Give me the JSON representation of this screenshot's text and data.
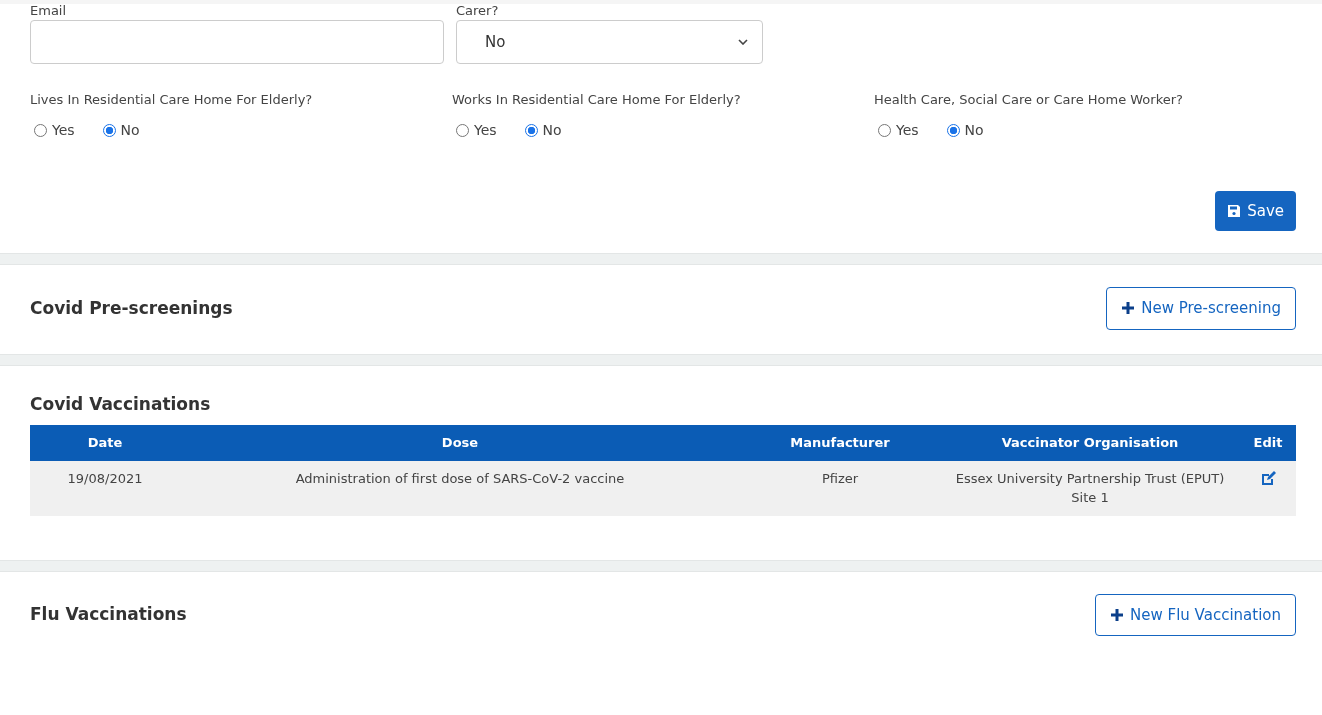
{
  "contact_form": {
    "fields": [
      {
        "label": "Email",
        "kind": "text"
      },
      {
        "label": "Carer?",
        "kind": "select",
        "value": "No"
      }
    ],
    "questions": [
      {
        "label": "Lives In Residential Care Home For Elderly?",
        "options": [
          {
            "label": "Yes",
            "selected": false
          },
          {
            "label": "No",
            "selected": true
          }
        ]
      },
      {
        "label": "Works In Residential Care Home For Elderly?",
        "options": [
          {
            "label": "Yes",
            "selected": false
          },
          {
            "label": "No",
            "selected": true
          }
        ]
      },
      {
        "label": "Health Care, Social Care or Care Home Worker?",
        "options": [
          {
            "label": "Yes",
            "selected": false
          },
          {
            "label": "No",
            "selected": true
          }
        ]
      }
    ],
    "save_button": "Save"
  },
  "sections": [
    {
      "title": "Covid Pre-screenings",
      "button": "New Pre-screening"
    },
    {
      "title": "Covid Vaccinations",
      "table": {
        "columns": [
          "Date",
          "Dose",
          "Manufacturer",
          "Vaccinator Organisation",
          "Edit"
        ],
        "rows": [
          [
            "19/08/2021",
            "Administration of first dose of SARS-CoV-2 vaccine",
            "Pfizer",
            "Essex University Partnership Trust (EPUT) Site 1"
          ]
        ]
      }
    },
    {
      "title": "Flu Vaccinations",
      "button": "New Flu Vaccination"
    }
  ]
}
